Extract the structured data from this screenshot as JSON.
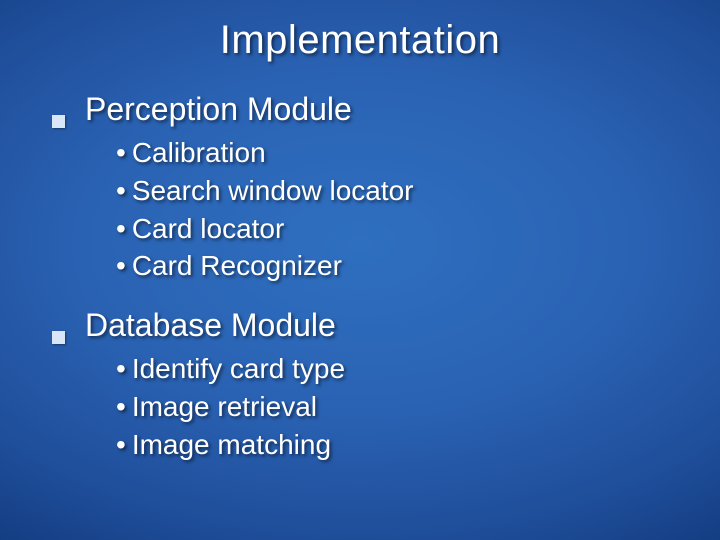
{
  "slide": {
    "title": "Implementation",
    "sections": [
      {
        "heading": "Perception Module",
        "items": [
          "Calibration",
          "Search window locator",
          "Card locator",
          "Card Recognizer"
        ]
      },
      {
        "heading": "Database Module",
        "items": [
          "Identify card type",
          "Image retrieval",
          "Image matching"
        ]
      }
    ]
  },
  "bullet_char": "•"
}
